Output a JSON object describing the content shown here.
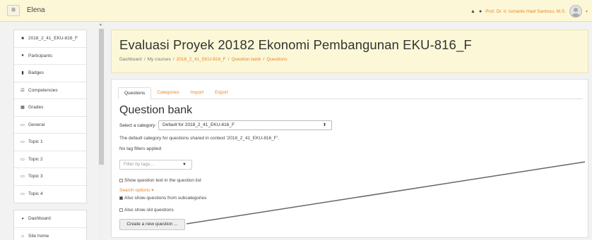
{
  "navbar": {
    "menu_icon": "hamburger-icon",
    "site_name": "Elena",
    "user_name": "Prof. Dr. Ir. Ismanto Hadi Santoso, M.S."
  },
  "drawer": {
    "course_items": [
      {
        "label": "2018_2_41_EKU-816_F",
        "icon": "graduation-cap-icon"
      },
      {
        "label": "Participants",
        "icon": "users-icon"
      },
      {
        "label": "Badges",
        "icon": "shield-icon"
      },
      {
        "label": "Competencies",
        "icon": "checkbox-icon"
      },
      {
        "label": "Grades",
        "icon": "table-icon"
      },
      {
        "label": "General",
        "icon": "folder-icon"
      },
      {
        "label": "Topic 1",
        "icon": "folder-icon"
      },
      {
        "label": "Topic 2",
        "icon": "folder-icon"
      },
      {
        "label": "Topic 3",
        "icon": "folder-icon"
      },
      {
        "label": "Topic 4",
        "icon": "folder-icon"
      }
    ],
    "site_items": [
      {
        "label": "Dashboard",
        "icon": "dashboard-icon"
      },
      {
        "label": "Site home",
        "icon": "home-icon"
      }
    ]
  },
  "header": {
    "title": "Evaluasi Proyek 20182 Ekonomi Pembangunan EKU-816_F",
    "breadcrumb": [
      "Dashboard",
      "My courses",
      "2018_2_41_EKU-816_F",
      "Question bank",
      "Questions"
    ]
  },
  "tabs": [
    "Questions",
    "Categories",
    "Import",
    "Export"
  ],
  "question_bank": {
    "title": "Question bank",
    "select_category_label": "Select a category:",
    "selected_category": "Default for 2018_2_41_EKU-816_F",
    "category_info": "The default category for questions shared in context '2018_2_41_EKU-816_F'.",
    "no_tag_filters": "No tag filters applied",
    "filter_placeholder": "Filter by tags...",
    "show_question_text": "Show question text in the question list",
    "search_options": "Search options",
    "show_subcategories": "Also show questions from subcategories",
    "show_old": "Also show old questions",
    "create_button": "Create a new question ..."
  },
  "colors": {
    "accent": "#e8842b",
    "navbar_bg": "#fcf8d7"
  }
}
